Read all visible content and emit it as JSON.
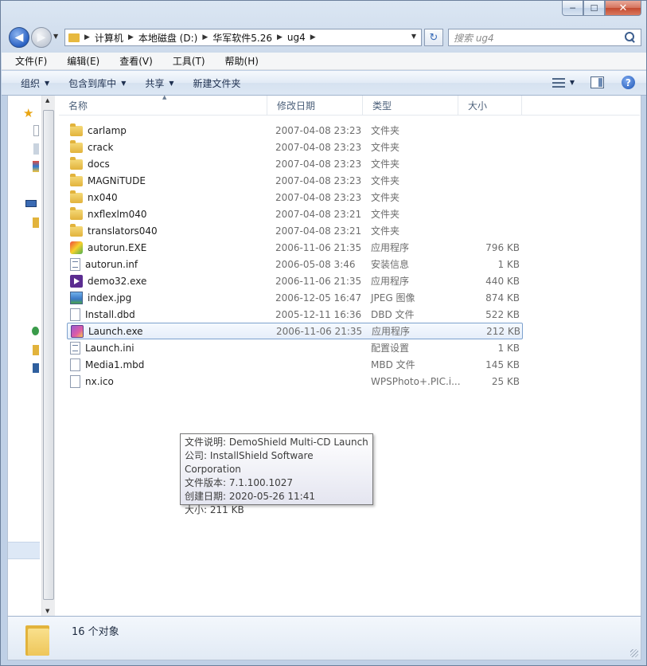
{
  "window": {
    "caption": {
      "minimize": "─",
      "maximize": "☐",
      "close": "✕"
    }
  },
  "address": {
    "crumbs": [
      "计算机",
      "本地磁盘 (D:)",
      "华军软件5.26",
      "ug4"
    ],
    "search_placeholder": "搜索 ug4"
  },
  "menu": [
    "文件(F)",
    "编辑(E)",
    "查看(V)",
    "工具(T)",
    "帮助(H)"
  ],
  "commands": [
    "组织",
    "包含到库中",
    "共享",
    "新建文件夹"
  ],
  "columns": {
    "name": "名称",
    "date": "修改日期",
    "type": "类型",
    "size": "大小"
  },
  "files": [
    {
      "name": "carlamp",
      "date": "2007-04-08 23:23",
      "type": "文件夹",
      "size": "",
      "icon": "folder-icon"
    },
    {
      "name": "crack",
      "date": "2007-04-08 23:23",
      "type": "文件夹",
      "size": "",
      "icon": "folder-icon"
    },
    {
      "name": "docs",
      "date": "2007-04-08 23:23",
      "type": "文件夹",
      "size": "",
      "icon": "folder-icon"
    },
    {
      "name": "MAGNiTUDE",
      "date": "2007-04-08 23:23",
      "type": "文件夹",
      "size": "",
      "icon": "folder-icon"
    },
    {
      "name": "nx040",
      "date": "2007-04-08 23:23",
      "type": "文件夹",
      "size": "",
      "icon": "folder-icon"
    },
    {
      "name": "nxflexlm040",
      "date": "2007-04-08 23:21",
      "type": "文件夹",
      "size": "",
      "icon": "folder-icon"
    },
    {
      "name": "translators040",
      "date": "2007-04-08 23:21",
      "type": "文件夹",
      "size": "",
      "icon": "folder-icon"
    },
    {
      "name": "autorun.EXE",
      "date": "2006-11-06 21:35",
      "type": "应用程序",
      "size": "796 KB",
      "icon": "exe-icon"
    },
    {
      "name": "autorun.inf",
      "date": "2006-05-08 3:46",
      "type": "安装信息",
      "size": "1 KB",
      "icon": "settings-file-icon"
    },
    {
      "name": "demo32.exe",
      "date": "2006-11-06 21:35",
      "type": "应用程序",
      "size": "440 KB",
      "icon": "demo-exe-icon"
    },
    {
      "name": "index.jpg",
      "date": "2006-12-05 16:47",
      "type": "JPEG 图像",
      "size": "874 KB",
      "icon": "image-icon"
    },
    {
      "name": "Install.dbd",
      "date": "2005-12-11 16:36",
      "type": "DBD 文件",
      "size": "522 KB",
      "icon": "blank-file-icon"
    },
    {
      "name": "Launch.exe",
      "date": "2006-11-06 21:35",
      "type": "应用程序",
      "size": "212 KB",
      "icon": "launch-exe-icon"
    },
    {
      "name": "Launch.ini",
      "date": "",
      "type": "配置设置",
      "size": "1 KB",
      "icon": "settings-file-icon"
    },
    {
      "name": "Media1.mbd",
      "date": "",
      "type": "MBD 文件",
      "size": "145 KB",
      "icon": "blank-file-icon"
    },
    {
      "name": "nx.ico",
      "date": "",
      "type": "WPSPhoto+.PIC.i...",
      "size": "25 KB",
      "icon": "blank-file-icon"
    }
  ],
  "tooltip": {
    "line1": "文件说明: DemoShield Multi-CD Launch",
    "line2": "公司: InstallShield Software Corporation",
    "line3": "文件版本: 7.1.100.1027",
    "line4": "创建日期: 2020-05-26 11:41",
    "line5": "大小: 211 KB"
  },
  "status": {
    "count": "16 个对象"
  }
}
